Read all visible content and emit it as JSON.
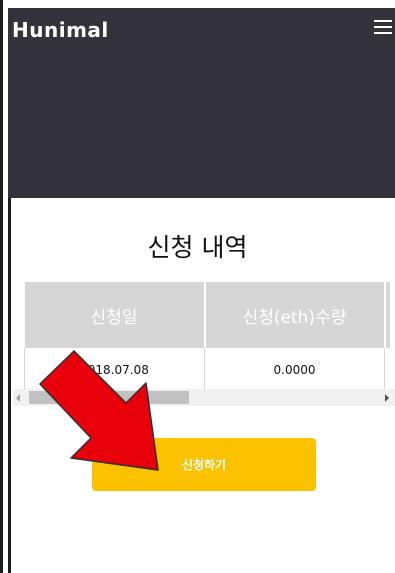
{
  "header": {
    "logo": "Hunimal",
    "background": "#34323b",
    "menu_icon": "hamburger-menu-icon"
  },
  "main": {
    "title": "신청 내역",
    "table": {
      "columns": [
        "신청일",
        "신청(eth)수량",
        ""
      ],
      "rows": [
        [
          "2018.07.08",
          "0.0000",
          ""
        ]
      ]
    },
    "apply_button": {
      "label": "신청하기",
      "color": "#fcc200"
    }
  },
  "annotation": {
    "arrow_color": "#e8000b",
    "icon": "red-arrow-pointer"
  }
}
